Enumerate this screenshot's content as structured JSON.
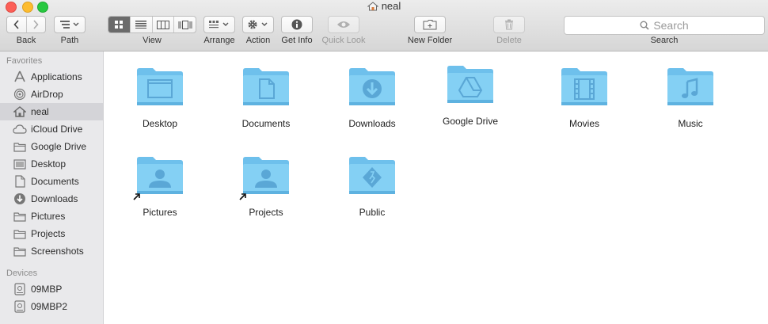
{
  "window": {
    "title": "neal"
  },
  "toolbar": {
    "back_label": "Back",
    "path_label": "Path",
    "view_label": "View",
    "arrange_label": "Arrange",
    "action_label": "Action",
    "getinfo_label": "Get Info",
    "quicklook_label": "Quick Look",
    "newfolder_label": "New Folder",
    "delete_label": "Delete",
    "search_label": "Search",
    "search_placeholder": "Search"
  },
  "sidebar": {
    "favorites_label": "Favorites",
    "devices_label": "Devices",
    "favorites": [
      {
        "label": "Applications",
        "icon": "applications-icon"
      },
      {
        "label": "AirDrop",
        "icon": "airdrop-icon"
      },
      {
        "label": "neal",
        "icon": "home-icon",
        "selected": true
      },
      {
        "label": "iCloud Drive",
        "icon": "cloud-icon"
      },
      {
        "label": "Google Drive",
        "icon": "folder-icon"
      },
      {
        "label": "Desktop",
        "icon": "desktop-icon"
      },
      {
        "label": "Documents",
        "icon": "document-icon"
      },
      {
        "label": "Downloads",
        "icon": "download-icon"
      },
      {
        "label": "Pictures",
        "icon": "pictures-icon"
      },
      {
        "label": "Projects",
        "icon": "folder-icon"
      },
      {
        "label": "Screenshots",
        "icon": "folder-icon"
      }
    ],
    "devices": [
      {
        "label": "09MBP",
        "icon": "hard-drive-icon"
      },
      {
        "label": "09MBP2",
        "icon": "hard-drive-icon"
      }
    ]
  },
  "content": {
    "items": [
      {
        "label": "Desktop",
        "icon": "desktop-folder-icon"
      },
      {
        "label": "Documents",
        "icon": "documents-folder-icon"
      },
      {
        "label": "Downloads",
        "icon": "downloads-folder-icon"
      },
      {
        "label": "Google Drive",
        "icon": "google-drive-folder-icon"
      },
      {
        "label": "Movies",
        "icon": "movies-folder-icon"
      },
      {
        "label": "Music",
        "icon": "music-folder-icon"
      },
      {
        "label": "Pictures",
        "icon": "pictures-folder-icon",
        "alias": true
      },
      {
        "label": "Projects",
        "icon": "projects-folder-icon",
        "alias": true
      },
      {
        "label": "Public",
        "icon": "public-folder-icon"
      }
    ]
  },
  "colors": {
    "folder": "#7ccbf0",
    "folder_dark": "#5fb6e3",
    "selection": "#d4d4d8"
  }
}
